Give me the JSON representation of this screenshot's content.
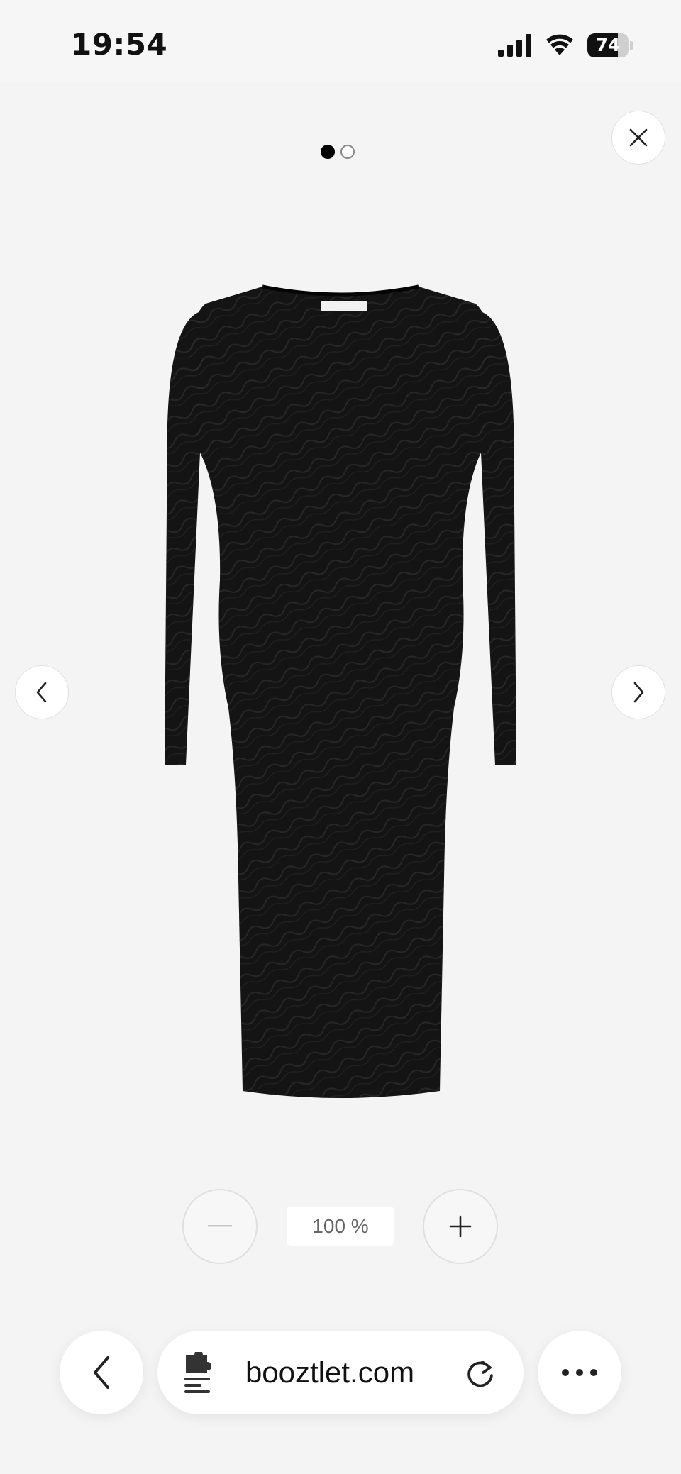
{
  "status_bar": {
    "time": "19:54",
    "battery_level": "74",
    "battery_fraction": 0.74
  },
  "viewer": {
    "slide_count": 2,
    "active_slide": 1,
    "close_icon": "close-icon",
    "prev_icon": "chevron-left-icon",
    "next_icon": "chevron-right-icon",
    "product_image": "black long-sleeve midi dress"
  },
  "zoom": {
    "level_label": "100 %",
    "out_icon": "minus-icon",
    "in_icon": "plus-icon"
  },
  "browser": {
    "url": "booztlet.com",
    "back_icon": "chevron-left-icon",
    "site_icon": "extension-icon",
    "reload_icon": "reload-icon",
    "more_icon": "more-icon"
  },
  "colors": {
    "page_background": "#f4f4f4",
    "active_dot": "#000000",
    "dress": "#141414"
  }
}
